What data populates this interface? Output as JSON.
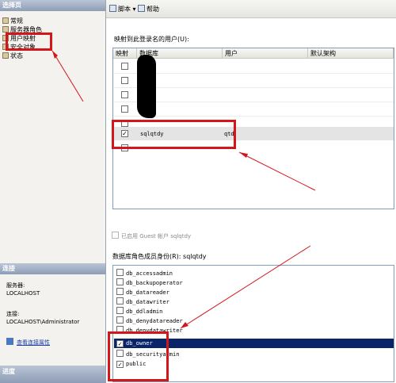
{
  "left_pane": {
    "select_page_header": "选择页",
    "nav_items": [
      {
        "label": "常规"
      },
      {
        "label": "服务器角色"
      },
      {
        "label": "用户映射"
      },
      {
        "label": "安全对象"
      },
      {
        "label": "状态"
      }
    ],
    "connection_header": "连接",
    "server_label": "服务器:",
    "server_value": "LOCALHOST",
    "connection_label": "连接:",
    "connection_value": "LOCALHOST\\Administrator",
    "view_connection_link": "查看连接属性",
    "progress_header": "进度"
  },
  "toolbar": {
    "script_label": "脚本",
    "help_label": "帮助"
  },
  "user_mapping": {
    "section_label": "映射到此登录名的用户(U):",
    "columns": [
      "映射",
      "数据库",
      "用户",
      "默认架构"
    ],
    "rows": [
      {
        "checked": false,
        "database": "",
        "user": ""
      },
      {
        "checked": false,
        "database": "",
        "user": ""
      },
      {
        "checked": false,
        "database": "",
        "user": ""
      },
      {
        "checked": false,
        "database": "",
        "user": ""
      },
      {
        "checked": false,
        "database": "",
        "user": ""
      },
      {
        "checked": true,
        "database": "sqlqtdy",
        "user": "qtd"
      },
      {
        "checked": false,
        "database": "",
        "user": ""
      }
    ]
  },
  "guest": {
    "label": "已启用 Guest 帐户  sqlqtdy"
  },
  "roles": {
    "section_label": "数据库角色成员身份(R): sqlqtdy",
    "items": [
      {
        "name": "db_accessadmin",
        "checked": false
      },
      {
        "name": "db_backupoperator",
        "checked": false
      },
      {
        "name": "db_datareader",
        "checked": false
      },
      {
        "name": "db_datawriter",
        "checked": false
      },
      {
        "name": "db_ddladmin",
        "checked": false
      },
      {
        "name": "db_denydatareader",
        "checked": false
      },
      {
        "name": "db_denydatawriter",
        "checked": false
      },
      {
        "name": "db_owner",
        "checked": true
      },
      {
        "name": "db_securityadmin",
        "checked": false
      },
      {
        "name": "public",
        "checked": true
      }
    ]
  },
  "colors": {
    "annotation": "#d4161b",
    "selected_row": "#0a246a",
    "header_blue": "#8e9db6"
  }
}
